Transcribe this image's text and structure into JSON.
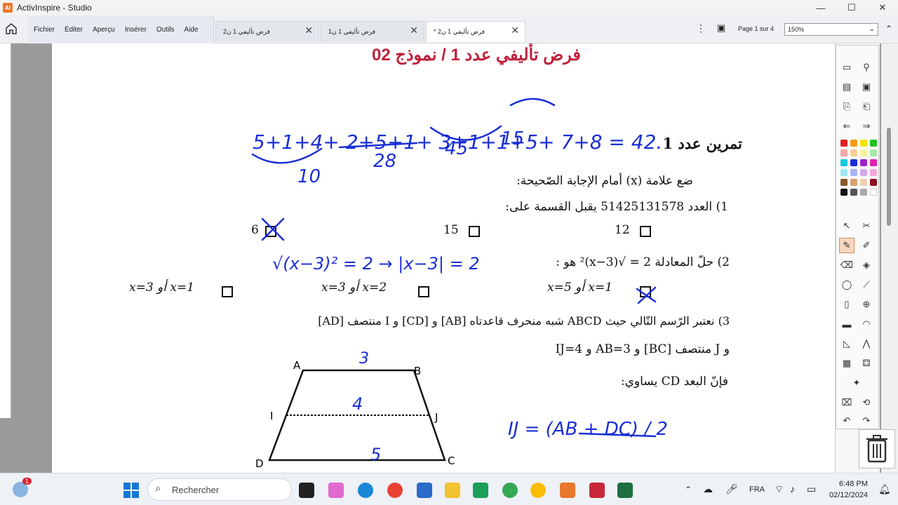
{
  "window": {
    "title": "ActivInspire - Studio",
    "app_icon": "AI",
    "minimize": "—",
    "maximize": "☐",
    "close": "✕"
  },
  "menu": {
    "items": [
      "Fichier",
      "Éditer",
      "Aperçu",
      "Insérer",
      "Outils",
      "Aide"
    ]
  },
  "tabs": [
    {
      "label": "فرض تأليفي 1 ن2",
      "close": "✕"
    },
    {
      "label": "فرض تأليفي 1 ن1",
      "close": "✕"
    },
    {
      "label": "* فرض تأليفي 1 ن2",
      "close": "✕"
    }
  ],
  "nav": {
    "page_info": "Page 1 sur 4",
    "zoom": "150%"
  },
  "document": {
    "title": "فرض تأليفي عدد 1 / نموذج 02",
    "exercise": "تمرين عدد 1",
    "instruction": "ضع علامة (x) أمام الإجابة الصّحيحة:",
    "q1": {
      "text": "1) العدد 51425131578 يقبل القسمة على:",
      "options": [
        "6",
        "15",
        "12"
      ]
    },
    "q2": {
      "text": "2) حلّ المعادلة 2 = √(x−3)² هو :",
      "options": [
        "x=1 أو x=3",
        "x=2 أو x=3",
        "x=1 أو x=5"
      ]
    },
    "q3": {
      "line1": "3) نعتبر الرّسم التّالي حيث ABCD شبه منحرف قاعدتاه [AB] و [CD] و I منتصف [AD]",
      "line2": "و J منتصف [BC] و AB=3 و IJ=4",
      "line3": "فإنّ البعد CD يساوي:"
    },
    "figure": {
      "labels": [
        "A",
        "B",
        "I",
        "J",
        "D",
        "C"
      ]
    },
    "handwriting": {
      "line1": "5+1+4+ 2+5+1+ 3+1+1+5+ 7+8 = 42.",
      "sums": [
        "10",
        "28",
        "45",
        "15"
      ],
      "sqrt_work": "√(x−3)² = 2 → |x−3| = 2",
      "fig_numbers": [
        "3",
        "4",
        "5"
      ],
      "formula": "IJ = (AB + DC) / 2"
    }
  },
  "taskbar": {
    "search": "Rechercher",
    "lang": "FRA",
    "time": "6:48 PM",
    "date": "02/12/2024",
    "badge": "1"
  },
  "colors": {
    "accent_red": "#c0213a",
    "ink_blue": "#1a2fd6",
    "selected_tool": "#e08a4e"
  }
}
